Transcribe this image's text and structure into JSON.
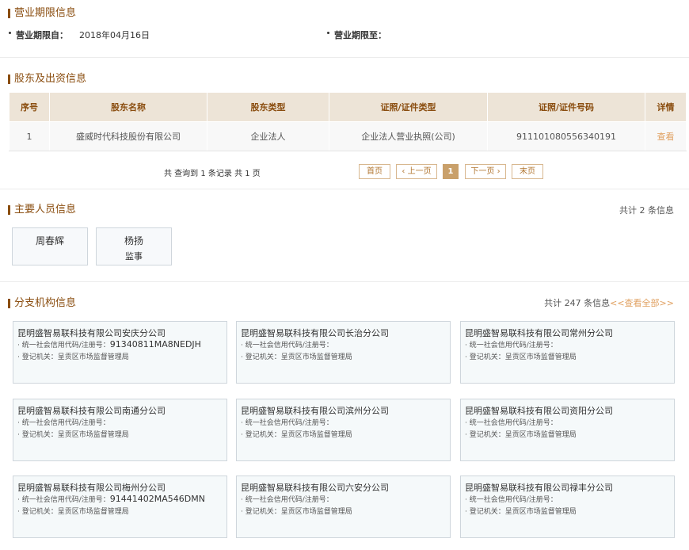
{
  "business_term": {
    "title": "营业期限信息",
    "from_label": "营业期限自：",
    "from_value": "2018年04月16日",
    "to_label": "营业期限至：",
    "to_value": ""
  },
  "shareholders": {
    "title": "股东及出资信息",
    "columns": [
      "序号",
      "股东名称",
      "股东类型",
      "证照/证件类型",
      "证照/证件号码",
      "详情"
    ],
    "rows": [
      [
        "1",
        "盛威时代科技股份有限公司",
        "企业法人",
        "企业法人营业执照(公司)",
        "911101080556340191",
        "查看"
      ]
    ],
    "pager": {
      "info": "共 查询到 1 条记录 共 1 页",
      "first": "首页",
      "prev": "‹ 上一页",
      "current": "1",
      "next": "下一页 ›",
      "last": "末页"
    }
  },
  "personnel": {
    "title": "主要人员信息",
    "count": "共计 2 条信息",
    "people": [
      {
        "name": "周春辉",
        "role": ""
      },
      {
        "name": "杨扬",
        "role": "监事"
      }
    ]
  },
  "branches": {
    "title": "分支机构信息",
    "count": "共计 247 条信息",
    "view_all": "<<查看全部>>",
    "credit_label": "· 统一社会信用代码/注册号：",
    "authority_label": "· 登记机关：",
    "items": [
      {
        "name": "昆明盛智易联科技有限公司安庆分公司",
        "code": "91340811MA8NEDJH",
        "authority": "呈贡区市场监督管理局"
      },
      {
        "name": "昆明盛智易联科技有限公司长治分公司",
        "code": "",
        "authority": "呈贡区市场监督管理局"
      },
      {
        "name": "昆明盛智易联科技有限公司常州分公司",
        "code": "",
        "authority": "呈贡区市场监督管理局"
      },
      {
        "name": "昆明盛智易联科技有限公司南通分公司",
        "code": "",
        "authority": "呈贡区市场监督管理局"
      },
      {
        "name": "昆明盛智易联科技有限公司滨州分公司",
        "code": "",
        "authority": "呈贡区市场监督管理局"
      },
      {
        "name": "昆明盛智易联科技有限公司资阳分公司",
        "code": "",
        "authority": "呈贡区市场监督管理局"
      },
      {
        "name": "昆明盛智易联科技有限公司梅州分公司",
        "code": "91441402MA546DMN",
        "authority": "呈贡区市场监督管理局"
      },
      {
        "name": "昆明盛智易联科技有限公司六安分公司",
        "code": "",
        "authority": "呈贡区市场监督管理局"
      },
      {
        "name": "昆明盛智易联科技有限公司禄丰分公司",
        "code": "",
        "authority": "呈贡区市场监督管理局"
      }
    ]
  }
}
